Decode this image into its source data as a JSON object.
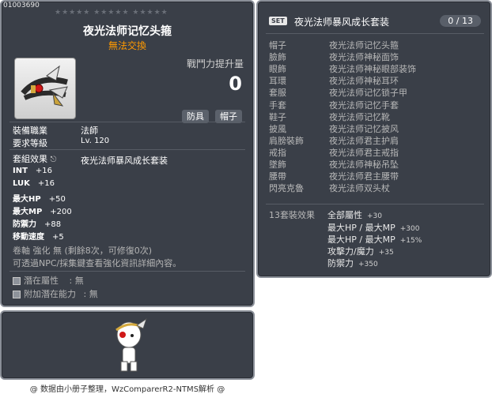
{
  "item": {
    "id": "01003690",
    "stars": "★★★★★  ★★★★★  ★★★★★",
    "title": "夜光法师记忆头箍",
    "trade": "無法交換",
    "attack_label": "戰鬥力提升量",
    "attack_value": "0",
    "tags": [
      "防具",
      "帽子"
    ],
    "job_label": "裝備職業",
    "job_value": "法師",
    "level_label": "要求等級",
    "level_value": "Lv. 120",
    "set_label": "套組效果",
    "set_value": "夜光法师暴风成长套装",
    "stats": [
      {
        "name": "INT",
        "value": "+16"
      },
      {
        "name": "LUK",
        "value": "+16"
      },
      {
        "name": "最大HP",
        "value": "+50"
      },
      {
        "name": "最大MP",
        "value": "+200"
      },
      {
        "name": "防禦力",
        "value": "+88"
      },
      {
        "name": "移動速度",
        "value": "+5"
      }
    ],
    "upgrade_line": "卷軸 強化 無 (剩餘8次，可修復0次)",
    "npc_line": "可透過NPC/採集鍵查看強化資訊詳細內容。",
    "potential_label": "潛在屬性",
    "potential_value": "無",
    "add_potential_label": "附加潛在能力",
    "add_potential_value": "無"
  },
  "set": {
    "badge": "SET",
    "title": "夜光法师暴风成长套装",
    "count": "0 / 13",
    "parts": [
      {
        "slot": "帽子",
        "name": "夜光法师记忆头箍"
      },
      {
        "slot": "臉飾",
        "name": "夜光法师神秘面饰"
      },
      {
        "slot": "眼飾",
        "name": "夜光法师神秘眼部装饰"
      },
      {
        "slot": "耳環",
        "name": "夜光法师神秘耳环"
      },
      {
        "slot": "套服",
        "name": "夜光法师记忆锁子甲"
      },
      {
        "slot": "手套",
        "name": "夜光法师记忆手套"
      },
      {
        "slot": "鞋子",
        "name": "夜光法师记忆靴"
      },
      {
        "slot": "披風",
        "name": "夜光法师记忆披风"
      },
      {
        "slot": "肩膀裝飾",
        "name": "夜光法师君主护肩"
      },
      {
        "slot": "戒指",
        "name": "夜光法师君主戒指"
      },
      {
        "slot": "墜飾",
        "name": "夜光法师神秘吊坠"
      },
      {
        "slot": "腰帶",
        "name": "夜光法师君主腰带"
      },
      {
        "slot": "閃亮克魯",
        "name": "夜光法师双头杖"
      }
    ],
    "effect_label": "13套裝效果",
    "effects": [
      {
        "name": "全部屬性",
        "value": "+30"
      },
      {
        "name": "最大HP / 最大MP",
        "value": "+300"
      },
      {
        "name": "最大HP / 最大MP",
        "value": "+15%"
      },
      {
        "name": "攻擊力/魔力",
        "value": "+35"
      },
      {
        "name": "防禦力",
        "value": "+350"
      }
    ]
  },
  "footer": "@ 数据由小册子整理，WzComparerR2-NTMS解析 @"
}
